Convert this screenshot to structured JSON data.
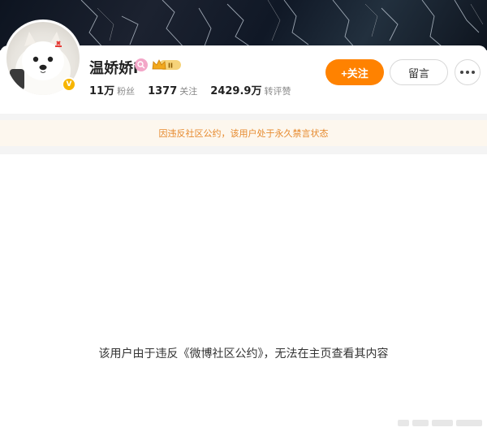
{
  "profile": {
    "username": "温娇娇i",
    "followers_value": "11万",
    "followers_label": "粉丝",
    "following_value": "1377",
    "following_label": "关注",
    "likes_value": "2429.9万",
    "likes_label": "转评赞",
    "level_badge": "II"
  },
  "actions": {
    "follow_label": "+关注",
    "message_label": "留言"
  },
  "notice": {
    "text": "因违反社区公约，该用户处于永久禁言状态"
  },
  "content": {
    "empty_message": "该用户由于违反《微博社区公约》，无法在主页查看其内容"
  },
  "colors": {
    "accent": "#ff8200",
    "notice_text": "#e68a2e",
    "notice_bg": "#fdf7ee"
  },
  "icons": {
    "more": "more-dots-icon",
    "verify": "verified-badge-icon",
    "pink_badge": "pink-search-badge-icon",
    "crown": "crown-level-icon"
  }
}
